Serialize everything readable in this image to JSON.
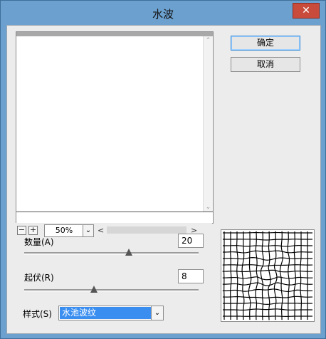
{
  "window": {
    "title": "水波",
    "close_glyph": "✕"
  },
  "buttons": {
    "ok": "确定",
    "cancel": "取消"
  },
  "preview": {
    "zoom_out": "−",
    "zoom_in": "+",
    "zoom_value": "50%",
    "dropdown_arrow": "⌄",
    "scroll_left": "<",
    "scroll_right": ">",
    "scroll_up": "⌃",
    "scroll_down": "⌄"
  },
  "params": {
    "amount": {
      "label": "数量(A)",
      "value": "20",
      "slider_fraction": 0.6
    },
    "ridges": {
      "label": "起伏(R)",
      "value": "8",
      "slider_fraction": 0.4
    }
  },
  "style": {
    "label": "样式(S)",
    "selected": "水池波纹",
    "arrow": "⌄"
  },
  "icons": {
    "ripple_preview": "ripple-grid-icon"
  }
}
